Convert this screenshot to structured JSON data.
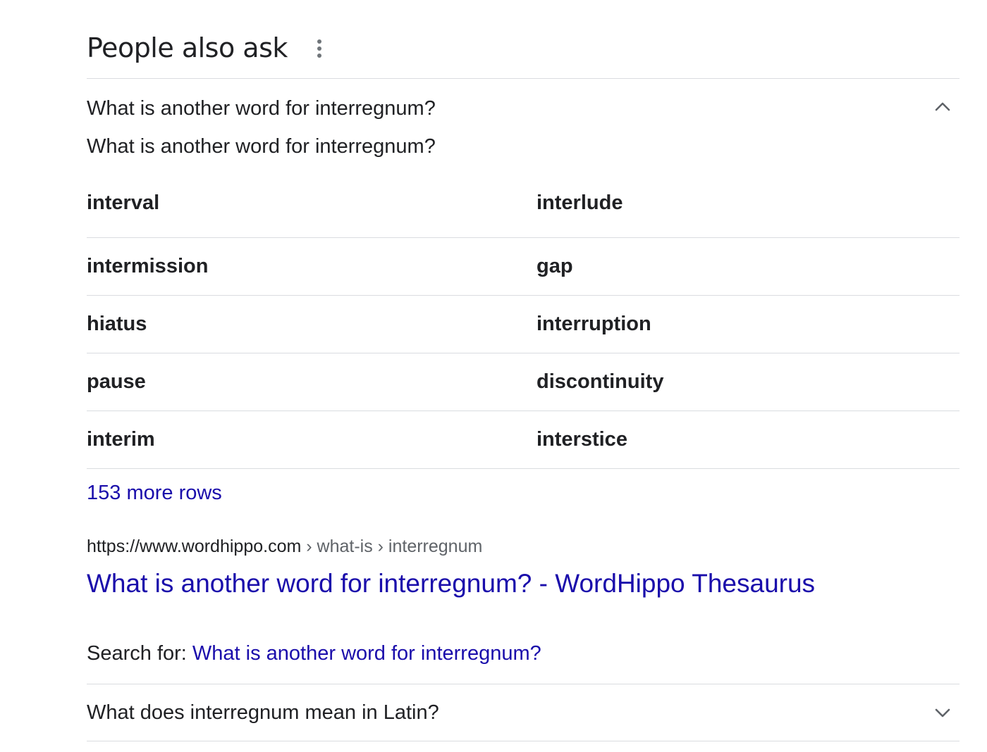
{
  "header": {
    "title": "People also ask",
    "menu_icon": "more-vert-icon"
  },
  "expanded_question": {
    "text": "What is another word for interregnum?",
    "toggle_icon": "chevron-up-icon",
    "answer_heading": "What is another word for interregnum?",
    "synonyms": [
      [
        "interval",
        "interlude"
      ],
      [
        "intermission",
        "gap"
      ],
      [
        "hiatus",
        "interruption"
      ],
      [
        "pause",
        "discontinuity"
      ],
      [
        "interim",
        "interstice"
      ]
    ],
    "more_rows": "153 more rows",
    "source": {
      "url": "https://www.wordhippo.com",
      "path": " › what-is › interregnum",
      "title": "What is another word for interregnum? - WordHippo Thesaurus"
    },
    "search_for_label": "Search for: ",
    "search_for_link": "What is another word for interregnum?"
  },
  "collapsed_question": {
    "text": "What does interregnum mean in Latin?",
    "toggle_icon": "chevron-down-icon"
  },
  "colors": {
    "link": "#1a0dab",
    "text": "#202124",
    "muted": "#5f6368",
    "divider": "#dadce0"
  }
}
